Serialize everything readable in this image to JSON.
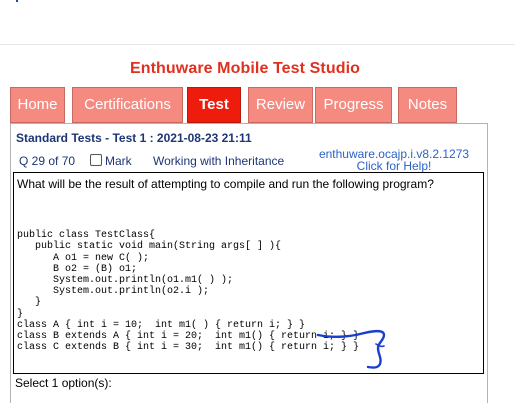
{
  "app": {
    "title": "Enthuware Mobile Test Studio"
  },
  "tabs": [
    {
      "label": "Home"
    },
    {
      "label": "Certifications"
    },
    {
      "label": "Test",
      "active": true
    },
    {
      "label": "Review"
    },
    {
      "label": "Progress"
    },
    {
      "label": "Notes"
    }
  ],
  "test": {
    "header": "Standard Tests - Test 1 : 2021-08-23 21:11",
    "question_number": "Q 29 of 70",
    "mark_label": "Mark",
    "mark_checked": false,
    "topic": "Working with Inheritance",
    "help_id": "enthuware.ocajp.i.v8.2.1273",
    "help_link": "Click for Help!"
  },
  "question": {
    "text": "What will be the result of attempting to compile and run the following program?",
    "code": "\npublic class TestClass{\n   public static void main(String args[ ] ){\n      A o1 = new C( );\n      B o2 = (B) o1;\n      System.out.println(o1.m1( ) );\n      System.out.println(o2.i );\n   }\n}\nclass A { int i = 10;  int m1( ) { return i; } }\nclass B extends A { int i = 20;  int m1() { return i; } }\nclass C extends B { int i = 30;  int m1() { return i; } }"
  },
  "options": {
    "select_text": "Select 1 option(s):"
  },
  "colors": {
    "title": "#e0301e",
    "tab": "#f48a80",
    "tab_active": "#ee1c0c",
    "header_text": "#1e3576",
    "link": "#2a63c8",
    "annotation": "#1a3fd0"
  }
}
